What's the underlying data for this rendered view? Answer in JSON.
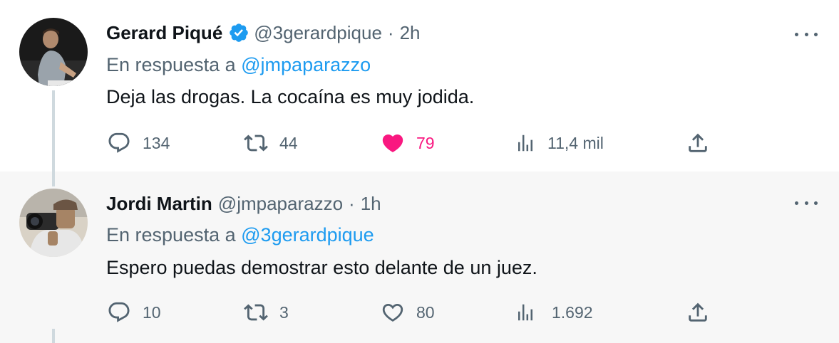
{
  "colors": {
    "text_primary": "#0f1419",
    "text_secondary": "#536471",
    "link": "#1d9bf0",
    "like_active": "#f91880",
    "verified": "#1d9bf0",
    "thread_line": "#cfd9de",
    "highlight_bg": "#f7f7f7"
  },
  "tweets": [
    {
      "author_name": "Gerard Piqué",
      "verified": true,
      "handle": "@3gerardpique",
      "separator": "·",
      "time": "2h",
      "reply_prefix": "En respuesta a",
      "reply_to": "@jmpaparazzo",
      "text": "Deja las drogas. La cocaína es muy jodida.",
      "replies": "134",
      "retweets": "44",
      "likes": "79",
      "liked": true,
      "views": "11,4 mil",
      "icons": [
        "reply-icon",
        "retweet-icon",
        "heart-filled-icon",
        "views-icon",
        "share-icon",
        "more-icon"
      ]
    },
    {
      "author_name": "Jordi Martin",
      "verified": false,
      "handle": "@jmpaparazzo",
      "separator": "·",
      "time": "1h",
      "reply_prefix": "En respuesta a",
      "reply_to": "@3gerardpique",
      "text": "Espero puedas demostrar esto delante de un juez.",
      "replies": "10",
      "retweets": "3",
      "likes": "80",
      "liked": false,
      "views": "1.692",
      "icons": [
        "reply-icon",
        "retweet-icon",
        "heart-outline-icon",
        "views-icon",
        "share-icon",
        "more-icon"
      ]
    }
  ]
}
